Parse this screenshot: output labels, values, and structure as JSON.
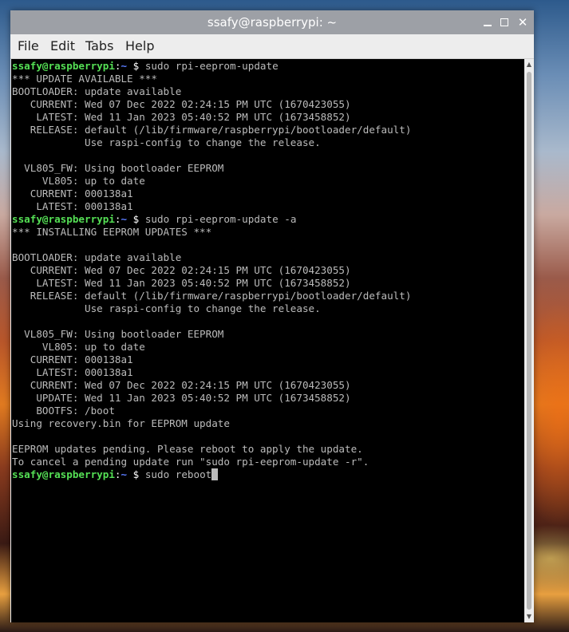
{
  "window": {
    "title": "ssafy@raspberrypi: ~",
    "controls": {
      "minimize": "minimize",
      "maximize": "maximize",
      "close": "✕"
    }
  },
  "menu": [
    "File",
    "Edit",
    "Tabs",
    "Help"
  ],
  "prompt": {
    "user": "ssafy@raspberrypi",
    "colon": ":",
    "path": "~",
    "dollar": " $ "
  },
  "lines": [
    {
      "type": "cmd",
      "text": "sudo rpi-eeprom-update"
    },
    {
      "type": "out",
      "text": "*** UPDATE AVAILABLE ***"
    },
    {
      "type": "out",
      "text": "BOOTLOADER: update available"
    },
    {
      "type": "out",
      "text": "   CURRENT: Wed 07 Dec 2022 02:24:15 PM UTC (1670423055)"
    },
    {
      "type": "out",
      "text": "    LATEST: Wed 11 Jan 2023 05:40:52 PM UTC (1673458852)"
    },
    {
      "type": "out",
      "text": "   RELEASE: default (/lib/firmware/raspberrypi/bootloader/default)"
    },
    {
      "type": "out",
      "text": "            Use raspi-config to change the release."
    },
    {
      "type": "out",
      "text": ""
    },
    {
      "type": "out",
      "text": "  VL805_FW: Using bootloader EEPROM"
    },
    {
      "type": "out",
      "text": "     VL805: up to date"
    },
    {
      "type": "out",
      "text": "   CURRENT: 000138a1"
    },
    {
      "type": "out",
      "text": "    LATEST: 000138a1"
    },
    {
      "type": "cmd",
      "text": "sudo rpi-eeprom-update -a"
    },
    {
      "type": "out",
      "text": "*** INSTALLING EEPROM UPDATES ***"
    },
    {
      "type": "out",
      "text": ""
    },
    {
      "type": "out",
      "text": "BOOTLOADER: update available"
    },
    {
      "type": "out",
      "text": "   CURRENT: Wed 07 Dec 2022 02:24:15 PM UTC (1670423055)"
    },
    {
      "type": "out",
      "text": "    LATEST: Wed 11 Jan 2023 05:40:52 PM UTC (1673458852)"
    },
    {
      "type": "out",
      "text": "   RELEASE: default (/lib/firmware/raspberrypi/bootloader/default)"
    },
    {
      "type": "out",
      "text": "            Use raspi-config to change the release."
    },
    {
      "type": "out",
      "text": ""
    },
    {
      "type": "out",
      "text": "  VL805_FW: Using bootloader EEPROM"
    },
    {
      "type": "out",
      "text": "     VL805: up to date"
    },
    {
      "type": "out",
      "text": "   CURRENT: 000138a1"
    },
    {
      "type": "out",
      "text": "    LATEST: 000138a1"
    },
    {
      "type": "out",
      "text": "   CURRENT: Wed 07 Dec 2022 02:24:15 PM UTC (1670423055)"
    },
    {
      "type": "out",
      "text": "    UPDATE: Wed 11 Jan 2023 05:40:52 PM UTC (1673458852)"
    },
    {
      "type": "out",
      "text": "    BOOTFS: /boot"
    },
    {
      "type": "out",
      "text": "Using recovery.bin for EEPROM update"
    },
    {
      "type": "out",
      "text": ""
    },
    {
      "type": "out",
      "text": "EEPROM updates pending. Please reboot to apply the update."
    },
    {
      "type": "out",
      "text": "To cancel a pending update run \"sudo rpi-eeprom-update -r\"."
    },
    {
      "type": "cmd",
      "text": "sudo reboot",
      "cursor": true
    }
  ],
  "colors": {
    "prompt_user": "#55e055",
    "prompt_path": "#5a7cff",
    "output_text": "#bbbbbb",
    "terminal_bg": "#000000",
    "titlebar_bg": "#9da0a6"
  }
}
